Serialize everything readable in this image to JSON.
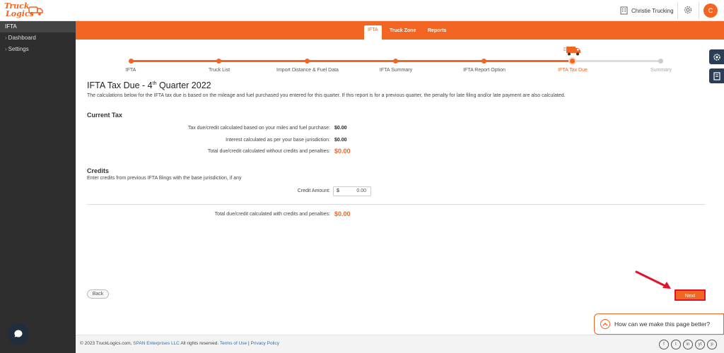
{
  "header": {
    "logo_line1": "Truck",
    "logo_line2": "Logics",
    "company_name": "Christie Trucking",
    "avatar_initial": "C"
  },
  "sidebar": {
    "section": "IFTA",
    "items": [
      {
        "label": "Dashboard"
      },
      {
        "label": "Settings"
      }
    ]
  },
  "nav": {
    "tabs": [
      {
        "label": "IFTA",
        "active": true
      },
      {
        "label": "Truck Zone",
        "active": false
      },
      {
        "label": "Reports",
        "active": false
      }
    ]
  },
  "stepper": {
    "steps": [
      {
        "label": "IFTA",
        "state": "done"
      },
      {
        "label": "Truck List",
        "state": "done"
      },
      {
        "label": "Import Distance & Fuel Data",
        "state": "done"
      },
      {
        "label": "IFTA Summary",
        "state": "done"
      },
      {
        "label": "IFTA Report Option",
        "state": "done"
      },
      {
        "label": "IFTA Tax Due",
        "state": "current"
      },
      {
        "label": "Summary",
        "state": "future"
      }
    ]
  },
  "page": {
    "title_prefix": "IFTA Tax Due - 4",
    "title_sup": "th",
    "title_suffix": " Quarter 2022",
    "description": "The calculations below for the IFTA tax due is based on the mileage and fuel purchased you entered for this quarter. If this report is for a previous quarter, the penalty for late filing and/or late payment are also calculated."
  },
  "current_tax": {
    "heading": "Current Tax",
    "rows": [
      {
        "label": "Tax due/credit calculated based on your miles and fuel purchase:",
        "value": "$0.00"
      },
      {
        "label": "Interest calculated as per your base jurisdiction:",
        "value": "$0.00"
      },
      {
        "label": "Total due/credit calculated without credits and penalties:",
        "value": "$0.00"
      }
    ]
  },
  "credits": {
    "heading": "Credits",
    "description": "Enter credits from previous IFTA filings with the base jurisdiction, if any",
    "amount_label": "Credit Amount:",
    "currency": "$",
    "amount_value": "0.00"
  },
  "total": {
    "label": "Total due/credit calculated with credits and penalties:",
    "value": "$0.00"
  },
  "actions": {
    "back_label": "Back",
    "next_label": "Next"
  },
  "feedback": {
    "label": "How can we make this page better?"
  },
  "footer": {
    "copyright": "© 2023 TruckLogics.com,",
    "company_link": "SPAN Enterprises LLC",
    "rights": "All rights reserved.",
    "terms_link": "Terms of Use",
    "separator": "|",
    "privacy_link": "Privacy Policy",
    "socials": [
      "f",
      "t",
      "in",
      "yt",
      "p"
    ]
  },
  "colors": {
    "brand_orange": "#f26522",
    "sidebar_bg": "#2e2e2e",
    "highlight_red": "#e0142d",
    "float_icon_bg": "#2c3e55"
  },
  "icons": {
    "company": "building-icon",
    "settings": "gear-icon",
    "truck": "truck-icon",
    "chat": "chat-icon",
    "arrow": "red-arrow-icon",
    "feedback": "chevron-up-icon"
  }
}
